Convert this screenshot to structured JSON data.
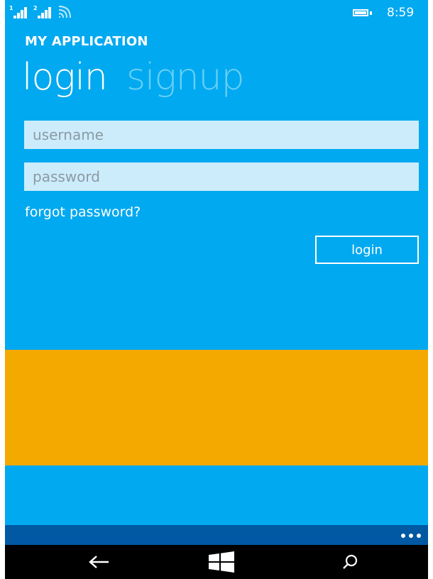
{
  "status_bar": {
    "sim1_label": "1",
    "sim2_label": "2",
    "time": "8:59",
    "icons": [
      "signal-icon",
      "signal-icon",
      "wifi-icon",
      "battery-icon"
    ]
  },
  "app": {
    "title": "MY APPLICATION",
    "pivot": [
      {
        "label": "login",
        "active": true
      },
      {
        "label": "signup",
        "active": false
      }
    ]
  },
  "form": {
    "username_placeholder": "username",
    "username_value": "",
    "password_placeholder": "password",
    "password_value": "",
    "forgot_label": "forgot password?",
    "login_label": "login"
  },
  "app_bar": {
    "more_icon": "more-icon"
  },
  "nav_bar": {
    "buttons": [
      "back-arrow-icon",
      "windows-logo-icon",
      "search-icon"
    ]
  },
  "colors": {
    "background": "#01a9f0",
    "input_background": "#ccecfc",
    "inactive_pivot": "#68cff6",
    "accent_panel": "#f4a900",
    "app_bar": "#0158a3",
    "nav_bar": "#000000"
  }
}
